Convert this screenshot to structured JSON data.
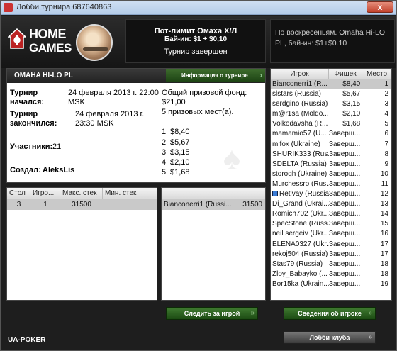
{
  "window": {
    "title": "Лобби турнира 687640863",
    "close_label": "x"
  },
  "header": {
    "logo_line1": "HOME",
    "logo_line2": "GAMES",
    "game_name": "Пот-лимит Омаха Х/Л",
    "buyin": "Бай-ин: $1 + $0,10",
    "status": "Турнир завершен",
    "description": "По воскресеньям. Omaha Hi-LO PL, бай-ин: $1+$0.10"
  },
  "info": {
    "game_type": "OMAHA HI-LO PL",
    "tournament_info_tab": "Информация о турнире",
    "started_label": "Турнир начался:",
    "started_value_date": "24 февраля 2013 г. 22:00",
    "started_value_tz": "MSK",
    "finished_label": "Турнир закончился:",
    "finished_value_date": "24 февраля 2013 г.",
    "finished_value_time": "23:30 MSK",
    "participants_label": "Участники:",
    "participants_value": "21",
    "created_label": "Создал:",
    "created_value": "AleksLis",
    "prize_pool_label": "Общий призовой фонд:",
    "prize_pool_value": "$21,00",
    "prize_places": "5 призовых мест(а).",
    "prizes": [
      {
        "place": "1",
        "amount": "$8,40"
      },
      {
        "place": "2",
        "amount": "$5,67"
      },
      {
        "place": "3",
        "amount": "$3,15"
      },
      {
        "place": "4",
        "amount": "$2,10"
      },
      {
        "place": "5",
        "amount": "$1,68"
      }
    ]
  },
  "tables": {
    "columns": [
      "Стол",
      "Игро...",
      "Макс. стек",
      "Мин. стек"
    ],
    "rows": [
      {
        "table": "3",
        "players": "1",
        "max": "31500",
        "min": ""
      }
    ]
  },
  "table_players": {
    "rows": [
      {
        "name": "Bianconerri1 (Russi...",
        "chips": "31500"
      }
    ]
  },
  "players": {
    "columns": [
      "Игрок",
      "Фишек",
      "Место"
    ],
    "rows": [
      {
        "name": "Bianconerri1 (R...",
        "chips": "$8,40",
        "place": "1",
        "selected": true
      },
      {
        "name": "slstars (Russia)",
        "chips": "$5,67",
        "place": "2"
      },
      {
        "name": "serdgino (Russia)",
        "chips": "$3,15",
        "place": "3"
      },
      {
        "name": "m@r1sa (Moldo...",
        "chips": "$2,10",
        "place": "4"
      },
      {
        "name": "Volkodavsha (R...",
        "chips": "$1,68",
        "place": "5"
      },
      {
        "name": "mamamio57 (U...",
        "chips": "Заверш...",
        "place": "6"
      },
      {
        "name": "mifox (Ukraine)",
        "chips": "Заверш...",
        "place": "7"
      },
      {
        "name": "SHURIK333 (Rus...",
        "chips": "Заверш...",
        "place": "8"
      },
      {
        "name": "SDELTA (Russia)",
        "chips": "Заверш...",
        "place": "9"
      },
      {
        "name": "storogh (Ukraine)",
        "chips": "Заверш...",
        "place": "10"
      },
      {
        "name": "Murchessro (Rus...",
        "chips": "Заверш...",
        "place": "11"
      },
      {
        "name": "Retivay (Russia)",
        "chips": "Заверш...",
        "place": "12",
        "flag": true
      },
      {
        "name": "Di_Grand (Ukrai...",
        "chips": "Заверш...",
        "place": "13"
      },
      {
        "name": "Romich702 (Ukr...",
        "chips": "Заверш...",
        "place": "14"
      },
      {
        "name": "SpecStone (Russ...",
        "chips": "Заверш...",
        "place": "15"
      },
      {
        "name": "neil sergeiv (Ukr...",
        "chips": "Заверш...",
        "place": "16"
      },
      {
        "name": "ELENA0327 (Ukr...",
        "chips": "Заверш...",
        "place": "17"
      },
      {
        "name": "rekoj504 (Russia)",
        "chips": "Заверш...",
        "place": "17"
      },
      {
        "name": "Stas79 (Russia)",
        "chips": "Заверш...",
        "place": "18"
      },
      {
        "name": "Zloy_Babayko (...",
        "chips": "Заверш...",
        "place": "18"
      },
      {
        "name": "Bor15ka (Ukrain...",
        "chips": "Заверш...",
        "place": "19"
      }
    ]
  },
  "buttons": {
    "watch_game": "Следить за игрой",
    "player_info": "Сведения об игроке",
    "club_lobby": "Лобби клуба"
  },
  "footer": {
    "club_name": "UA-POKER"
  }
}
